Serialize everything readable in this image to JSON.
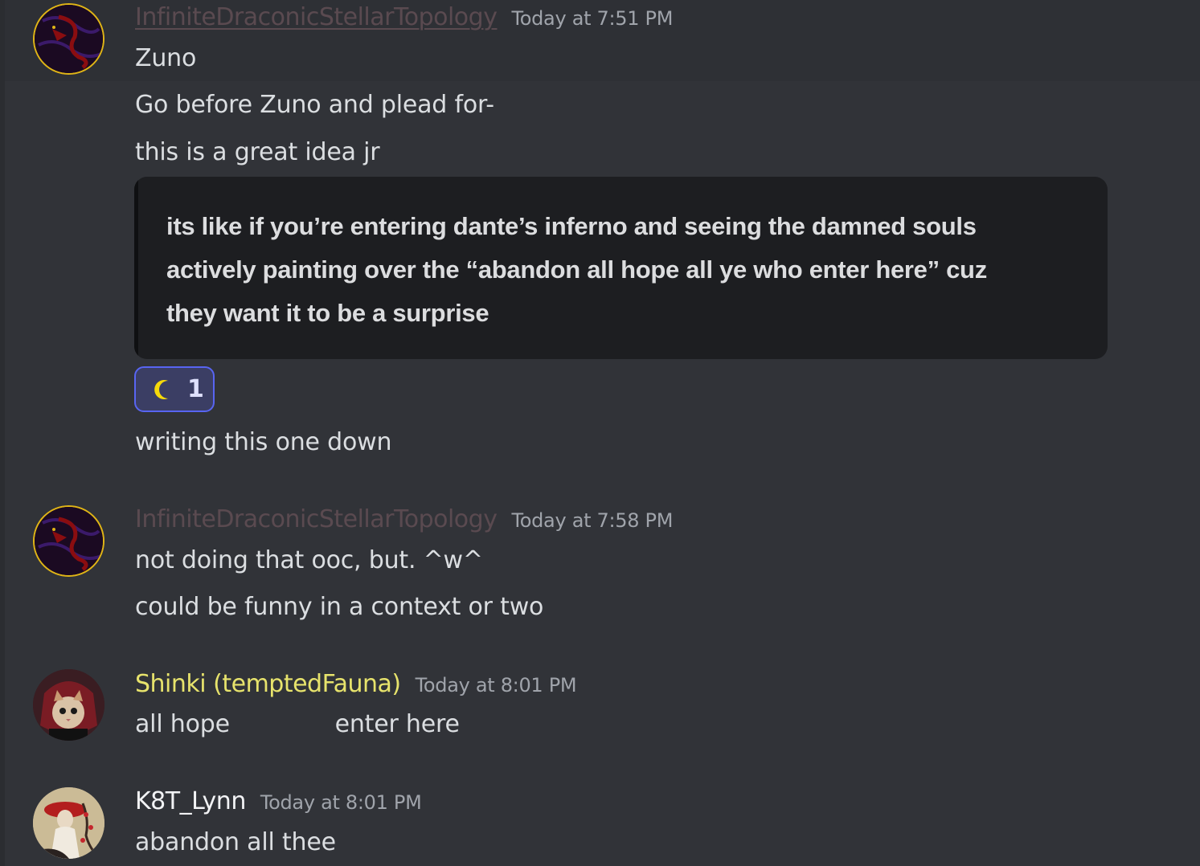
{
  "messages": [
    {
      "author": "InfiniteDraconicStellarTopology",
      "timestamp": "Today at 7:51 PM",
      "lines": [
        "Zuno",
        "Go before Zuno and plead for-",
        "this is a great idea jr"
      ],
      "embed_quote": [
        "its like if you’re entering dante’s inferno and seeing the damned souls",
        "actively painting over the “abandon all hope all ye who enter here” cuz",
        "they want it to be a surprise"
      ],
      "reaction": {
        "icon": "crescent-moon-icon",
        "count": "1"
      },
      "after_reaction": "writing this one down"
    },
    {
      "author": "InfiniteDraconicStellarTopology",
      "timestamp": "Today at 7:58 PM",
      "lines": [
        "not doing that ooc, but. ^w^",
        "could be funny in a context or two"
      ]
    },
    {
      "author": "Shinki (temptedFauna)",
      "timestamp": "Today at 8:01 PM",
      "lines": [
        "all hope              enter here"
      ]
    },
    {
      "author": "K8T_Lynn",
      "timestamp": "Today at 8:01 PM",
      "lines": [
        "abandon all thee"
      ]
    }
  ],
  "colors": {
    "background": "#313338",
    "username_muted": "#5a4a50",
    "username_shinki": "#e7e36c",
    "reaction_border": "#5865f2",
    "moon": "#f5d90a"
  }
}
